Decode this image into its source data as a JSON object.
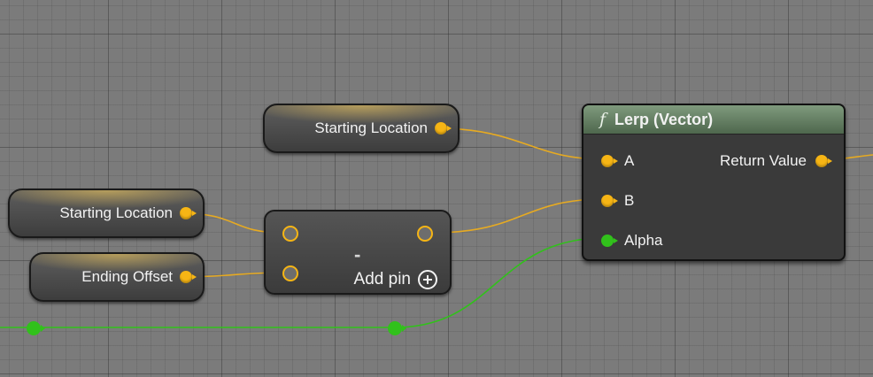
{
  "nodes": {
    "top_starting_location": {
      "label": "Starting Location"
    },
    "left_starting_location": {
      "label": "Starting Location"
    },
    "ending_offset": {
      "label": "Ending Offset"
    },
    "subtract": {
      "operator": "-",
      "add_pin_label": "Add pin"
    },
    "lerp": {
      "title": "Lerp (Vector)",
      "func_icon": "f",
      "inputs": {
        "a": "A",
        "b": "B",
        "alpha": "Alpha"
      },
      "output": "Return Value"
    }
  },
  "colors": {
    "vector_pin": "#f6b515",
    "float_pin": "#31c11b",
    "lerp_header": "#6e8a6c",
    "background": "#7b7b7b"
  },
  "icons": {
    "function": "function-icon",
    "add_pin": "plus-circle-icon"
  }
}
